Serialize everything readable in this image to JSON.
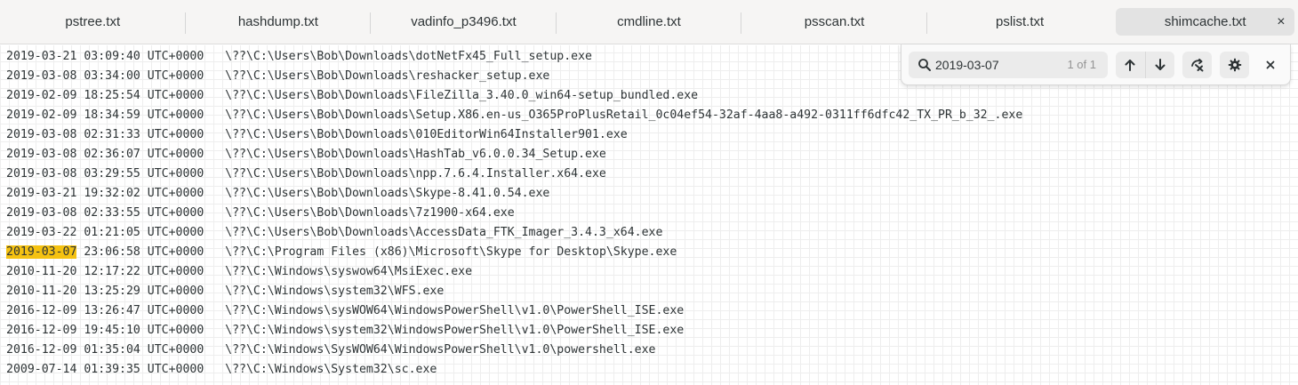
{
  "tabs": [
    {
      "label": "pstree.txt"
    },
    {
      "label": "hashdump.txt"
    },
    {
      "label": "vadinfo_p3496.txt"
    },
    {
      "label": "cmdline.txt"
    },
    {
      "label": "psscan.txt"
    },
    {
      "label": "pslist.txt"
    },
    {
      "label": "shimcache.txt",
      "active": true,
      "close_label": "×"
    }
  ],
  "find": {
    "query": "2019-03-07",
    "match_count": "1 of 1",
    "close_label": "×",
    "icons": {
      "search": "search-icon",
      "previous": "arrow-up-icon",
      "next": "arrow-down-icon",
      "replace": "find-replace-icon",
      "settings": "gear-icon",
      "close": "close-icon"
    }
  },
  "lines": [
    {
      "timestamp": "2019-03-21 03:09:40 UTC+0000",
      "path": "\\??\\C:\\Users\\Bob\\Downloads\\dotNetFx45_Full_setup.exe"
    },
    {
      "timestamp": "2019-03-08 03:34:00 UTC+0000",
      "path": "\\??\\C:\\Users\\Bob\\Downloads\\reshacker_setup.exe"
    },
    {
      "timestamp": "2019-02-09 18:25:54 UTC+0000",
      "path": "\\??\\C:\\Users\\Bob\\Downloads\\FileZilla_3.40.0_win64-setup_bundled.exe"
    },
    {
      "timestamp": "2019-02-09 18:34:59 UTC+0000",
      "path": "\\??\\C:\\Users\\Bob\\Downloads\\Setup.X86.en-us_O365ProPlusRetail_0c04ef54-32af-4aa8-a492-0311ff6dfc42_TX_PR_b_32_.exe"
    },
    {
      "timestamp": "2019-03-08 02:31:33 UTC+0000",
      "path": "\\??\\C:\\Users\\Bob\\Downloads\\010EditorWin64Installer901.exe"
    },
    {
      "timestamp": "2019-03-08 02:36:07 UTC+0000",
      "path": "\\??\\C:\\Users\\Bob\\Downloads\\HashTab_v6.0.0.34_Setup.exe"
    },
    {
      "timestamp": "2019-03-08 03:29:55 UTC+0000",
      "path": "\\??\\C:\\Users\\Bob\\Downloads\\npp.7.6.4.Installer.x64.exe"
    },
    {
      "timestamp": "2019-03-21 19:32:02 UTC+0000",
      "path": "\\??\\C:\\Users\\Bob\\Downloads\\Skype-8.41.0.54.exe"
    },
    {
      "timestamp": "2019-03-08 02:33:55 UTC+0000",
      "path": "\\??\\C:\\Users\\Bob\\Downloads\\7z1900-x64.exe"
    },
    {
      "timestamp": "2019-03-22 01:21:05 UTC+0000",
      "path": "\\??\\C:\\Users\\Bob\\Downloads\\AccessData_FTK_Imager_3.4.3_x64.exe"
    },
    {
      "highlight": "2019-03-07",
      "timestamp": " 23:06:58 UTC+0000",
      "path": "\\??\\C:\\Program Files (x86)\\Microsoft\\Skype for Desktop\\Skype.exe"
    },
    {
      "timestamp": "2010-11-20 12:17:22 UTC+0000",
      "path": "\\??\\C:\\Windows\\syswow64\\MsiExec.exe"
    },
    {
      "timestamp": "2010-11-20 13:25:29 UTC+0000",
      "path": "\\??\\C:\\Windows\\system32\\WFS.exe"
    },
    {
      "timestamp": "2016-12-09 13:26:47 UTC+0000",
      "path": "\\??\\C:\\Windows\\sysWOW64\\WindowsPowerShell\\v1.0\\PowerShell_ISE.exe"
    },
    {
      "timestamp": "2016-12-09 19:45:10 UTC+0000",
      "path": "\\??\\C:\\Windows\\system32\\WindowsPowerShell\\v1.0\\PowerShell_ISE.exe"
    },
    {
      "timestamp": "2016-12-09 01:35:04 UTC+0000",
      "path": "\\??\\C:\\Windows\\SysWOW64\\WindowsPowerShell\\v1.0\\powershell.exe"
    },
    {
      "timestamp": "2009-07-14 01:39:35 UTC+0000",
      "path": "\\??\\C:\\Windows\\System32\\sc.exe"
    }
  ]
}
